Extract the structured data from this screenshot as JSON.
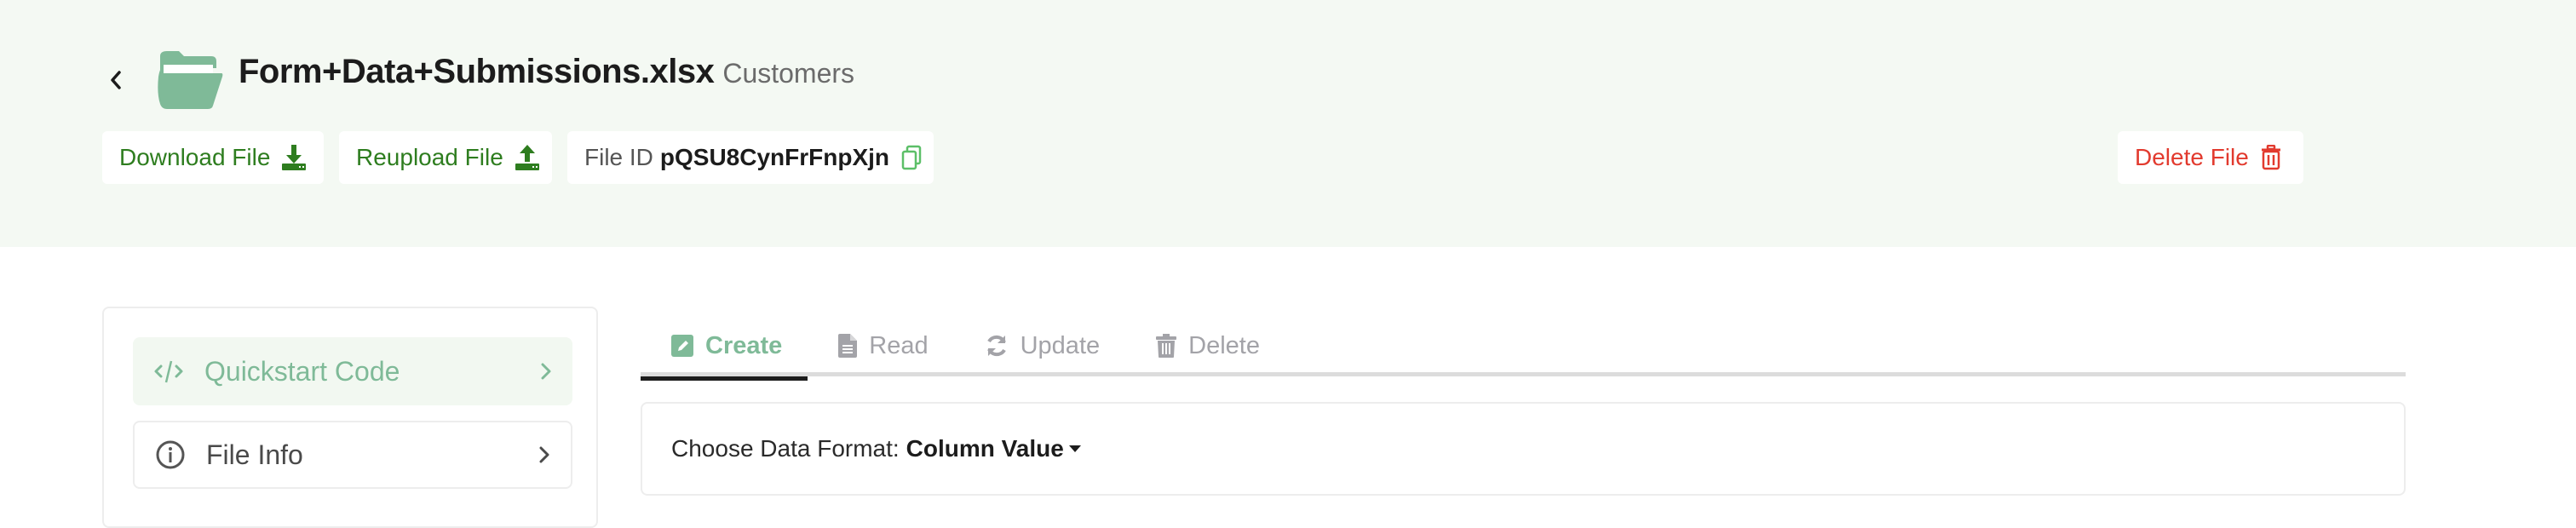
{
  "header": {
    "file_name": "Form+Data+Submissions.xlsx",
    "sheet_name": "Customers",
    "back_icon": "chevron-left-icon",
    "folder_icon": "folder-open-icon",
    "buttons": {
      "download": {
        "label": "Download File",
        "icon": "download-icon"
      },
      "reupload": {
        "label": "Reupload File",
        "icon": "upload-icon"
      },
      "delete": {
        "label": "Delete File",
        "icon": "trash-icon"
      }
    },
    "file_id": {
      "label": "File ID",
      "value": "pQSU8CynFrFnpXjn",
      "icon": "copy-icon"
    }
  },
  "sidebar": {
    "items": [
      {
        "label": "Quickstart Code",
        "icon": "code-icon",
        "active": true
      },
      {
        "label": "File Info",
        "icon": "info-icon",
        "active": false
      }
    ]
  },
  "tabs": [
    {
      "label": "Create",
      "icon": "edit-icon",
      "active": true
    },
    {
      "label": "Read",
      "icon": "file-icon",
      "active": false
    },
    {
      "label": "Update",
      "icon": "refresh-icon",
      "active": false
    },
    {
      "label": "Delete",
      "icon": "trash-icon",
      "active": false
    }
  ],
  "format": {
    "label": "Choose Data Format:",
    "selected": "Column Value"
  },
  "colors": {
    "accent_green": "#7fba98",
    "button_green": "#2e7d1f",
    "danger_red": "#e23a2e",
    "header_bg": "#f4f9f3"
  }
}
